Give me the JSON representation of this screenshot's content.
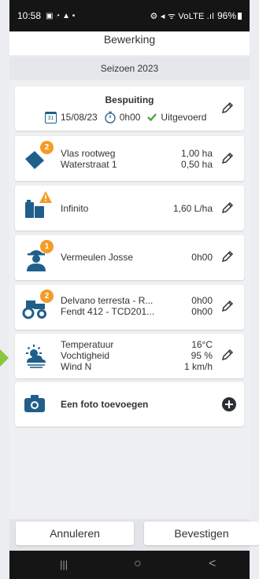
{
  "status": {
    "time": "10:58",
    "left_icons": "▣ ◔ ▲ •",
    "right_icons": "⚙ ◂ ᯤ VoLTE .ıl",
    "battery": "96%"
  },
  "header": {
    "title": "Bewerking"
  },
  "season": {
    "label": "Seizoen 2023"
  },
  "summary": {
    "title": "Bespuiting",
    "date": "15/08/23",
    "date_day": "31",
    "duration": "0h00",
    "status": "Uitgevoerd"
  },
  "fields": {
    "badge": "2",
    "names": [
      "Vlas rootweg",
      "Waterstraat 1"
    ],
    "values": [
      "1,00 ha",
      "0,50 ha"
    ]
  },
  "product": {
    "badge": "!",
    "name": "Infinito",
    "value": "1,60 L/ha"
  },
  "worker": {
    "badge": "1",
    "name": "Vermeulen Josse",
    "value": "0h00"
  },
  "machines": {
    "badge": "2",
    "names": [
      "Delvano terresta - R...",
      "Fendt 412 - TCD201..."
    ],
    "values": [
      "0h00",
      "0h00"
    ]
  },
  "weather": {
    "labels": [
      "Temperatuur",
      "Vochtigheid",
      "Wind N"
    ],
    "values": [
      "16°C",
      "95 %",
      "1 km/h"
    ]
  },
  "photo": {
    "label": "Een foto toevoegen"
  },
  "footer": {
    "cancel": "Annuleren",
    "confirm": "Bevestigen"
  },
  "nav": {
    "recents": "|||",
    "home": "○",
    "back": "<"
  },
  "colors": {
    "accent_blue": "#1f5f8b",
    "badge_orange": "#f39c25",
    "green": "#49a83c",
    "arrow_green": "#8bc53f"
  }
}
